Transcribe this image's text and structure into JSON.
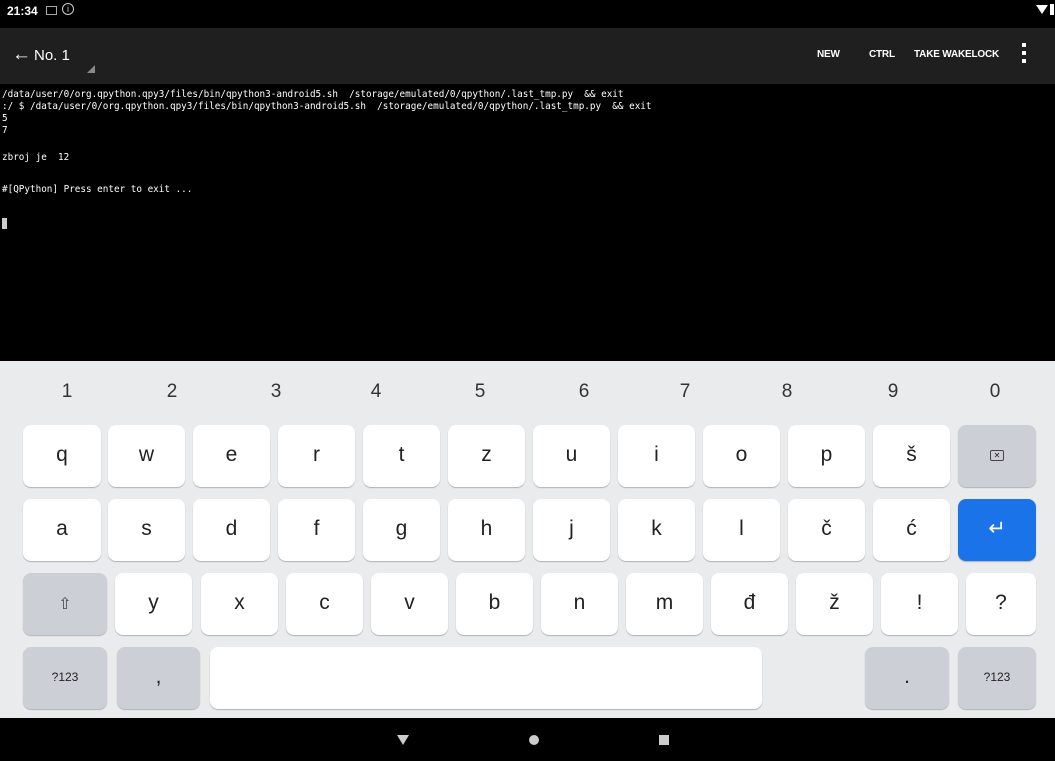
{
  "status": {
    "time": "21:34"
  },
  "appbar": {
    "back": "←",
    "title": "No. 1",
    "actions": {
      "new": "NEW",
      "ctrl": "CTRL",
      "wakelock": "TAKE WAKELOCK"
    }
  },
  "terminal": {
    "lines": [
      "/data/user/0/org.qpython.qpy3/files/bin/qpython3-android5.sh  /storage/emulated/0/qpython/.last_tmp.py  && exit",
      ":/ $ /data/user/0/org.qpython.qpy3/files/bin/qpython3-android5.sh  /storage/emulated/0/qpython/.last_tmp.py  && exit",
      "5",
      "7",
      "zbroj je  12",
      "",
      "#[QPython] Press enter to exit ..."
    ]
  },
  "keyboard": {
    "numbers": [
      "1",
      "2",
      "3",
      "4",
      "5",
      "6",
      "7",
      "8",
      "9",
      "0"
    ],
    "row1": [
      "q",
      "w",
      "e",
      "r",
      "t",
      "z",
      "u",
      "i",
      "o",
      "p",
      "š"
    ],
    "row2": [
      "a",
      "s",
      "d",
      "f",
      "g",
      "h",
      "j",
      "k",
      "l",
      "č",
      "ć"
    ],
    "row3": [
      "y",
      "x",
      "c",
      "v",
      "b",
      "n",
      "m",
      "đ",
      "ž",
      "!",
      "?"
    ],
    "symbols_left": "?123",
    "comma": ",",
    "period": ".",
    "symbols_right": "?123",
    "enter": "↵",
    "shift": "⇧",
    "backspace": "✕"
  }
}
